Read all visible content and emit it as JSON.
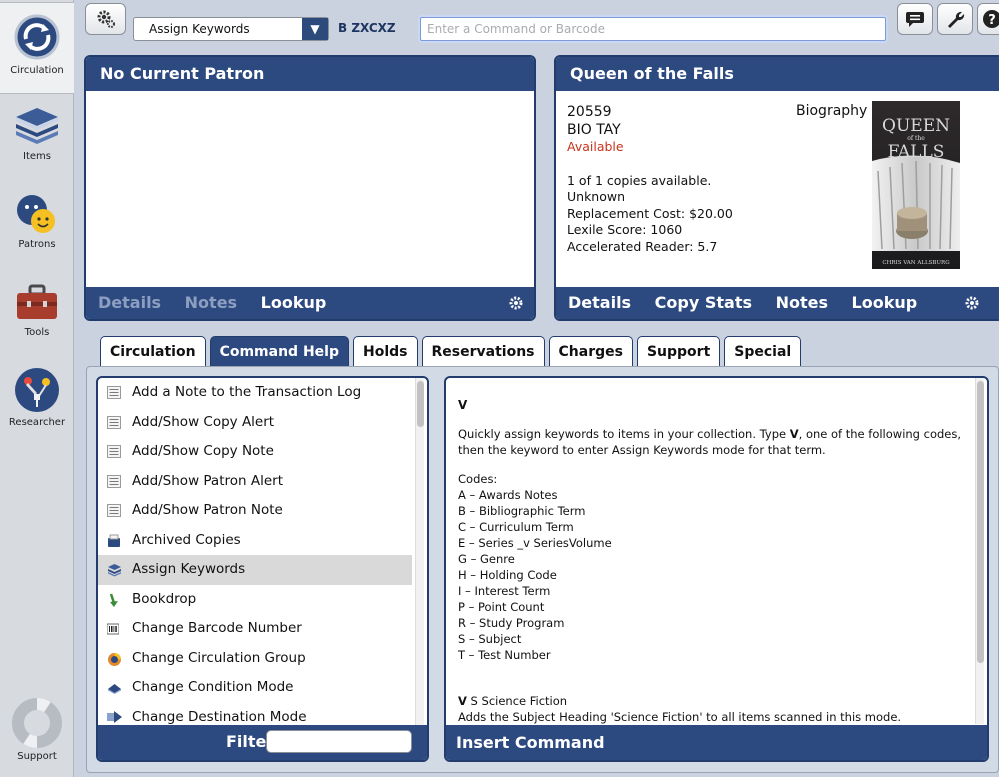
{
  "colors": {
    "navy": "#2d4a80",
    "status_red": "#c8331d",
    "selected_row": "#d9d9d9"
  },
  "sidebar": {
    "items": [
      {
        "label": "Circulation",
        "icon": "circulation-icon",
        "active": true
      },
      {
        "label": "Items",
        "icon": "books-stack-icon"
      },
      {
        "label": "Patrons",
        "icon": "patrons-faces-icon"
      },
      {
        "label": "Tools",
        "icon": "toolbox-icon"
      },
      {
        "label": "Researcher",
        "icon": "researcher-pin-icon"
      },
      {
        "label": "Support",
        "icon": "life-ring-icon"
      }
    ]
  },
  "toolbar": {
    "mode_selected": "Assign Keywords",
    "barcode_prefix": "B ZXCXZ",
    "command_placeholder": "Enter a Command or Barcode",
    "icons": [
      "gear-icon",
      "message-icon",
      "wrench-icon",
      "help-icon"
    ]
  },
  "patron": {
    "header": "No Current Patron",
    "footer": {
      "details": "Details",
      "notes": "Notes",
      "lookup": "Lookup"
    }
  },
  "title": {
    "header": "Queen of the Falls",
    "call_number": "20559",
    "shelf_code": "BIO TAY",
    "status": "Available",
    "genre": "Biography",
    "copies": "1 of 1 copies available.",
    "condition": "Unknown",
    "replacement_cost": "Replacement Cost: $20.00",
    "lexile": "Lexile Score: 1060",
    "accelerated_reader": "Accelerated Reader: 5.7",
    "cover": {
      "title_line1": "QUEEN",
      "title_line2": "of the",
      "title_line3": "FALLS",
      "author": "CHRIS VAN ALLSBURG"
    },
    "footer": {
      "details": "Details",
      "copy_stats": "Copy Stats",
      "notes": "Notes",
      "lookup": "Lookup"
    }
  },
  "tabs": [
    {
      "label": "Circulation",
      "active": false
    },
    {
      "label": "Command Help",
      "active": true
    },
    {
      "label": "Holds",
      "active": false
    },
    {
      "label": "Reservations",
      "active": false
    },
    {
      "label": "Charges",
      "active": false
    },
    {
      "label": "Support",
      "active": false
    },
    {
      "label": "Special",
      "active": false
    }
  ],
  "commands": {
    "items": [
      {
        "label": "Add a Note to the Transaction Log",
        "icon": "note-list-icon"
      },
      {
        "label": "Add/Show Copy Alert",
        "icon": "note-list-icon"
      },
      {
        "label": "Add/Show Copy Note",
        "icon": "note-list-icon"
      },
      {
        "label": "Add/Show Patron Alert",
        "icon": "note-list-icon"
      },
      {
        "label": "Add/Show Patron Note",
        "icon": "note-list-icon"
      },
      {
        "label": "Archived Copies",
        "icon": "archive-box-icon"
      },
      {
        "label": "Assign Keywords",
        "icon": "books-stack-icon",
        "selected": true
      },
      {
        "label": "Bookdrop",
        "icon": "down-arrow-icon"
      },
      {
        "label": "Change Barcode Number",
        "icon": "barcode-icon"
      },
      {
        "label": "Change Circulation Group",
        "icon": "circle-group-icon"
      },
      {
        "label": "Change Condition Mode",
        "icon": "book-condition-icon"
      },
      {
        "label": "Change Destination Mode",
        "icon": "arrow-destination-icon"
      }
    ],
    "filter_label": "Filter",
    "filter_value": ""
  },
  "help": {
    "command_letter": "V",
    "description_pre": "Quickly assign keywords to items in your collection. Type ",
    "description_key": "V",
    "description_post": ", one of the following codes, then the keyword to enter Assign Keywords mode for that term.",
    "codes_heading": "Codes:",
    "codes": [
      "A – Awards Notes",
      "B – Bibliographic Term",
      "C – Curriculum Term",
      "E – Series _v SeriesVolume",
      "G – Genre",
      "H – Holding Code",
      "I – Interest Term",
      "P – Point Count",
      "R – Study Program",
      "S – Subject",
      "T – Test Number"
    ],
    "example_key": "V",
    "example_rest": " S Science Fiction",
    "example_desc": "Adds the Subject Heading 'Science Fiction' to all items scanned in this mode.",
    "insert_label": "Insert Command"
  }
}
